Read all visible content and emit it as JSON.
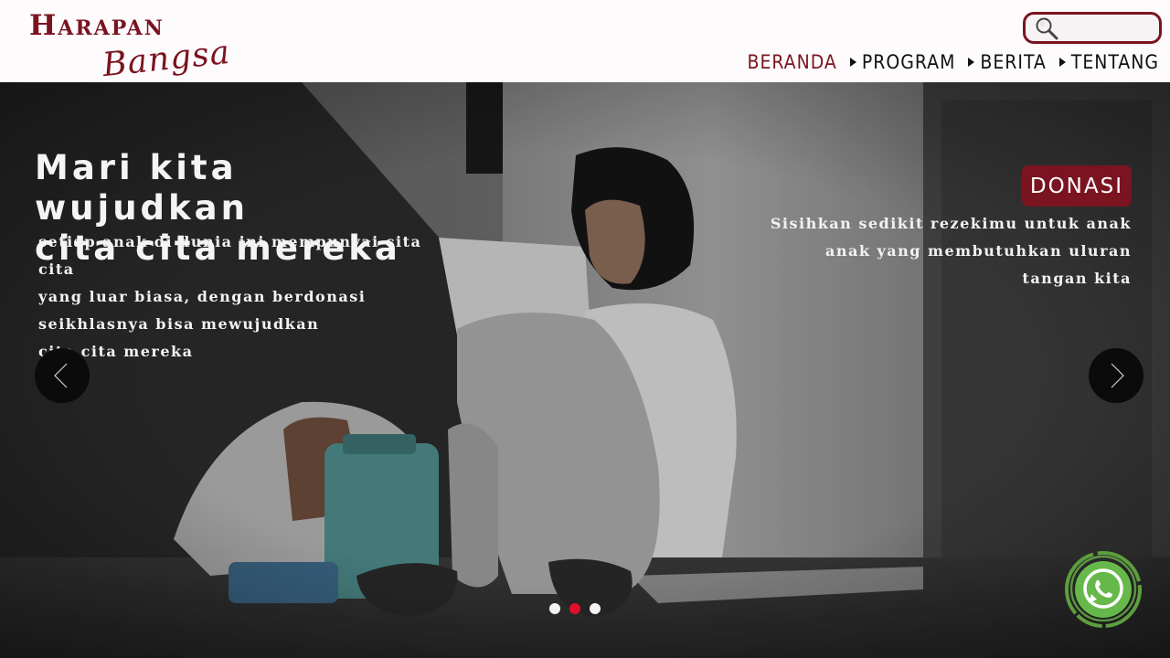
{
  "logo": {
    "top": "Harapan",
    "bottom": "Bangsa"
  },
  "search": {
    "placeholder": "",
    "value": ""
  },
  "nav": {
    "items": [
      {
        "label": "BERANDA",
        "active": true
      },
      {
        "label": "PROGRAM",
        "active": false
      },
      {
        "label": "BERITA",
        "active": false
      },
      {
        "label": "TENTANG",
        "active": false
      }
    ]
  },
  "hero": {
    "title": "Mari kita wujudkan\ncita cita mereka",
    "description": "setiap anak di dunia ini mempunyai cita cita\nyang luar biasa, dengan berdonasi\nseikhlasnya bisa mewujudkan\ncita cita mereka",
    "donate_label": "DONASI",
    "donate_description": "Sisihkan sedikit rezekimu untuk anak\nanak yang membutuhkan uluran\ntangan kita"
  },
  "carousel": {
    "slide_count": 3,
    "active_index": 1
  },
  "colors": {
    "brand": "#7a1420",
    "active_dot": "#e0102a",
    "whatsapp": "#6ab04c"
  },
  "icons": {
    "search": "search-icon",
    "prev": "chevron-left-icon",
    "next": "chevron-right-icon",
    "whatsapp": "whatsapp-icon"
  }
}
